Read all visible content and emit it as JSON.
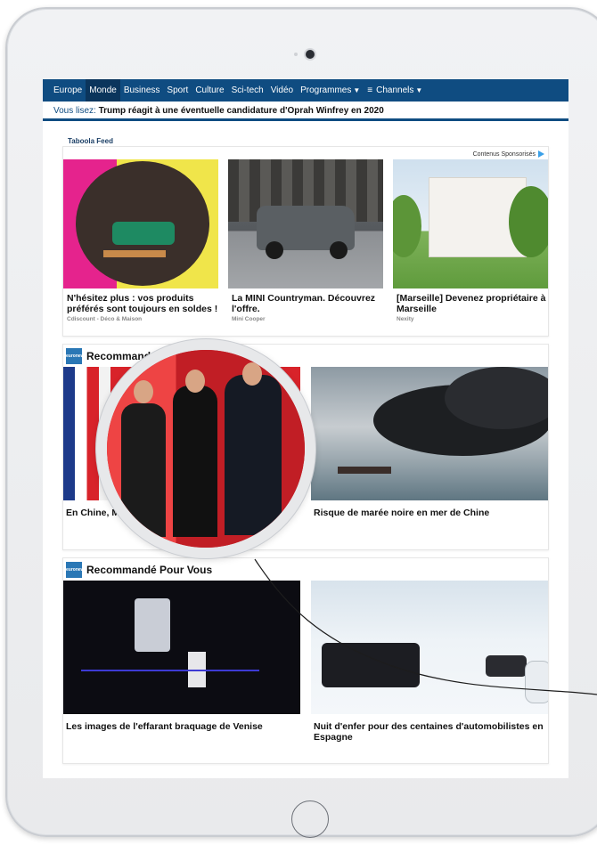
{
  "nav": {
    "items": [
      "Europe",
      "Monde",
      "Business",
      "Sport",
      "Culture",
      "Sci-tech",
      "Vidéo"
    ],
    "active": "Monde",
    "programmes": "Programmes",
    "channels": "Channels"
  },
  "reading": {
    "prefix": "Vous lisez:",
    "headline": "Trump réagit à une éventuelle candidature d'Oprah Winfrey en 2020"
  },
  "taboola": {
    "logo": "Taboola Feed"
  },
  "sponsored": {
    "label": "Contenus Sponsorisés",
    "items": [
      {
        "title": "N'hésitez plus : vos produits préférés sont toujours en soldes !",
        "source": "Cdiscount - Déco & Maison"
      },
      {
        "title": "La MINI Countryman. Découvrez l'offre.",
        "source": "Mini Cooper"
      },
      {
        "title": "[Marseille] Devenez propriétaire à Marseille",
        "source": "Nexity"
      }
    ]
  },
  "rec1": {
    "heading": "Recommandé Pour Vous",
    "items": [
      {
        "title": "En Chine, Macron et Xi Jinping"
      },
      {
        "title": "Risque de marée noire en mer de Chine"
      }
    ]
  },
  "rec2": {
    "heading": "Recommandé Pour Vous",
    "items": [
      {
        "title": "Les images de l'effarant braquage de Venise"
      },
      {
        "title": "Nuit d'enfer pour des centaines d'automobilistes en Espagne"
      }
    ]
  },
  "brand_logo": "euronews.",
  "colors": {
    "nav_bg": "#0f4c81",
    "nav_active": "#0b355c",
    "accent": "#3aa0e8"
  }
}
